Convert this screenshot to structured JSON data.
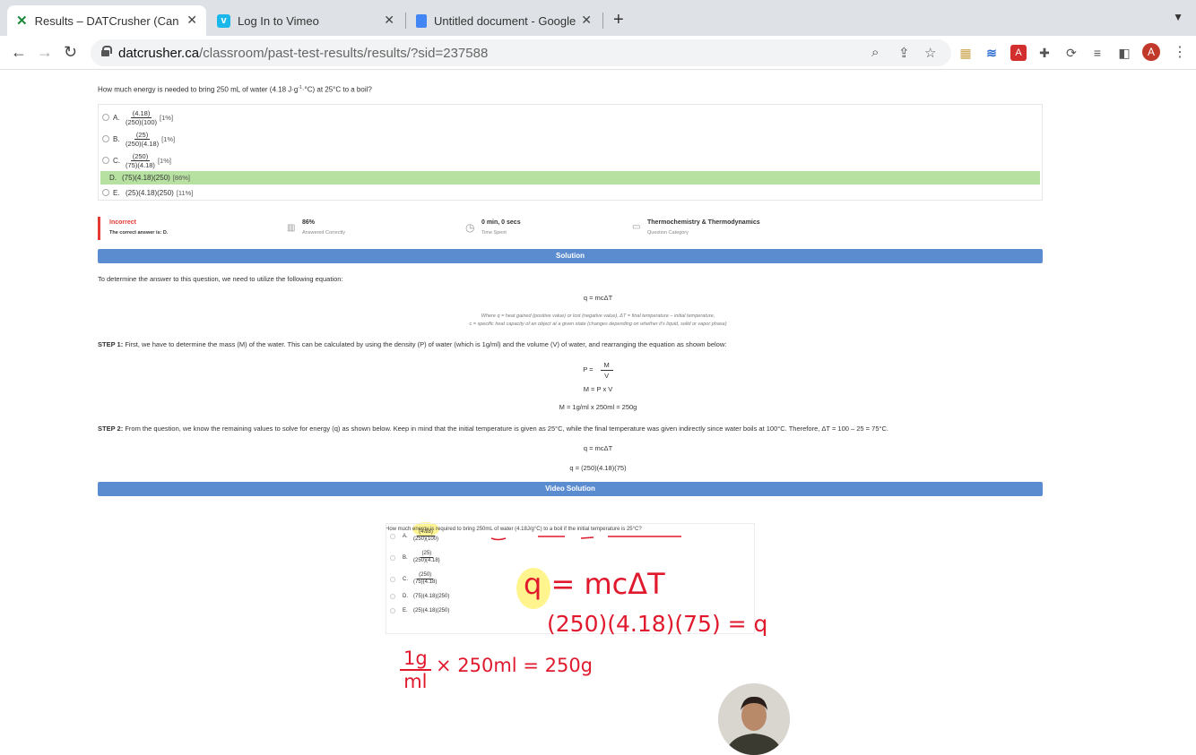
{
  "tabs": [
    {
      "title": "Results – DATCrusher (Canadian",
      "icon": "datcrusher-icon",
      "active": true
    },
    {
      "title": "Log In to Vimeo",
      "icon": "vimeo-icon"
    },
    {
      "title": "Untitled document - Google Docs",
      "icon": "google-docs-icon"
    }
  ],
  "url": {
    "domain": "datcrusher.ca",
    "path": "/classroom/past-test-results/results/?sid=237588"
  },
  "avatar_letter": "A",
  "question": {
    "text_pre": "How much energy is needed to bring 250 mL of water (4.18 J·g",
    "sup1": "-1",
    "text_mid": "·°C",
    "sup2": "",
    "text_post": ") at 25°C to a boil?",
    "options": [
      {
        "letter": "A.",
        "num": "(4.18)",
        "den": "(250)(100)",
        "pct": "[1%]"
      },
      {
        "letter": "B.",
        "num": "(25)",
        "den": "(250)(4.18)",
        "pct": "[1%]"
      },
      {
        "letter": "C.",
        "num": "(250)",
        "den": "(75)(4.18)",
        "pct": "[1%]"
      },
      {
        "letter": "D.",
        "text": "(75)(4.18)(250)",
        "pct": "[86%]"
      },
      {
        "letter": "E.",
        "text": "(25)(4.18)(250)",
        "pct": "[11%]"
      }
    ],
    "correct_option": "D."
  },
  "stats": {
    "status": "Incorrect",
    "status_sub": "The correct answer is: D.",
    "answered": "86%",
    "answered_sub": "Answered Correctly",
    "time": "0 min, 0 secs",
    "time_sub": "Time Spent",
    "category": "Thermochemistry & Thermodynamics",
    "category_sub": "Question Category"
  },
  "solution": {
    "header": "Solution",
    "intro": "To determine the answer to this question, we need to utilize the following equation:",
    "eq1": "q = mcΔT",
    "note1": "Where q = heat gained (positive value) or lost (negative value), ΔT = final temperature – initial temperature,",
    "note2": "c = specific heat capacity of an object at a given state (changes depending on whether it's liquid, solid or vapor phase)",
    "step1_label": "STEP 1:",
    "step1_text": "First, we have to determine the mass (M) of the water. This can be calculated by using the density (P) of water (which is 1g/ml) and the volume (V) of water, and rearranging the equation as shown below:",
    "density_lhs": "P  =",
    "density_num": "M",
    "density_den": "V",
    "mass_eq": "M  =  P  x  V",
    "mass_calc": "M  =  1g/ml  x  250ml  =  250g",
    "step2_label": "STEP 2:",
    "step2_text": "From the question, we know the remaining values to solve for energy (q) as shown below. Keep in mind that the initial temperature is given as 25°C, while the final temperature was given indirectly since water boils at 100°C. Therefore, ΔT = 100 – 25 = 75°C.",
    "eq2": "q = mcΔT",
    "eq3": "q = (250)(4.18)(75)"
  },
  "video": {
    "header": "Video Solution",
    "question": "How much energy is required to bring 250mL of water (4.18J/g°C) to a boil if the initial temperature is 25°C?",
    "options": [
      {
        "letter": "A.",
        "num": "(4.18)",
        "den": "(250)(100)"
      },
      {
        "letter": "B.",
        "num": "(25)",
        "den": "(250)(4.18)"
      },
      {
        "letter": "C.",
        "num": "(250)",
        "den": "(75)(4.18)"
      },
      {
        "letter": "D.",
        "text": "(75)(4.18)(250)"
      },
      {
        "letter": "E.",
        "text": "(25)(4.18)(250)"
      }
    ],
    "hw_eq1": "q = mcΔT",
    "hw_eq2": "(250)(4.18)(75) = q",
    "hw_num": "1g",
    "hw_den": "ml",
    "hw_eq3": "× 250ml = 250g"
  },
  "colors": {
    "correct": "#b7e1a1",
    "accent": "#5b8ccf",
    "incorrect": "#e53935",
    "handwriting": "#e0192d"
  }
}
